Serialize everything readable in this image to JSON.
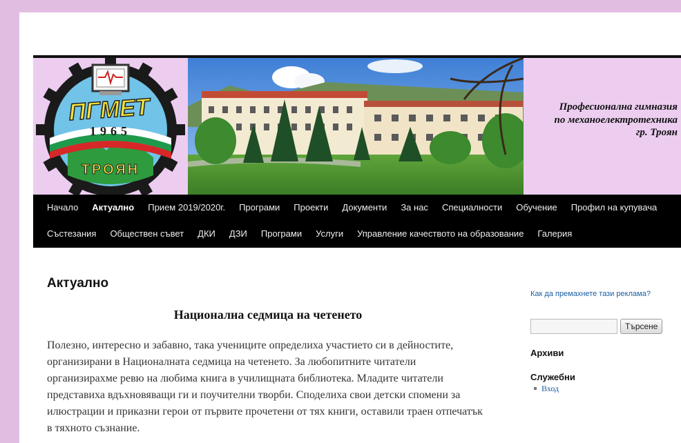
{
  "site": {
    "logo": {
      "text_top": "ПГМЕТ",
      "year": "1965",
      "text_bottom": "ТРОЯН"
    },
    "school_name_lines": [
      "Професионална гимназия",
      "по механоелектротехника",
      "гр. Троян"
    ]
  },
  "nav": {
    "row1": [
      "Начало",
      "Актуално",
      "Прием 2019/2020г.",
      "Програми",
      "Проекти",
      "Документи",
      "За нас",
      "Специалности",
      "Обучение",
      "Профил на купувача"
    ],
    "row2": [
      "Състезания",
      "Обществен съвет",
      "ДКИ",
      "ДЗИ",
      "Програми",
      "Услуги",
      "Управление качеството на образование",
      "Галерия"
    ],
    "active": "Актуално"
  },
  "main": {
    "page_title": "Актуално",
    "post_title": "Национална седмица на четенето",
    "post_body": "Полезно, интересно и забавно, така учениците определиха участието си в дейностите, организирани в Националната седмица на четенето. За любопитните читатели организирахме ревю на любима книга в училищната библиотека. Младите читатели представиха вдъхновяващи ги и поучителни творби. Споделиха свои детски спомени за илюстрации и приказни герои от първите прочетени от тях книги, оставили траен отпечатък в тяхното съзнание."
  },
  "sidebar": {
    "ad_link": "Как да премахнете тази реклама?",
    "search_value": "",
    "search_button": "Търсене",
    "archives_title": "Архиви",
    "service_title": "Служебни",
    "service_items": [
      "Вход"
    ]
  },
  "colors": {
    "background": "#e2bde2",
    "banner": "#eccdf0",
    "nav": "#000000",
    "link": "#1a5da0"
  }
}
